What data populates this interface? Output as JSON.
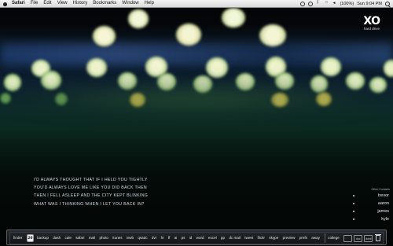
{
  "menubar": {
    "app": "Safari",
    "items": [
      "File",
      "Edit",
      "View",
      "History",
      "Bookmarks",
      "Window",
      "Help"
    ],
    "battery": "(100%)",
    "clock": "Sun 9:04 PM"
  },
  "widget": {
    "logo": "XO",
    "subtitle": "hard drive"
  },
  "lyrics": [
    "I'D ALWAYS THOUGHT THAT IF I HELD YOU TIGHTLY",
    "YOU'D ALWAYS LOVE ME LIKE YOU DID BACK THEN",
    "THEN I FELL ASLEEP AND THE CITY KEPT BLINKING",
    "WHAT WAS I THINKING WHEN I LET YOU BACK IN?"
  ],
  "contacts": {
    "title": "Other Contacts",
    "names": [
      "trevor",
      "aaron",
      "james",
      "kyle"
    ]
  },
  "dock": {
    "items": [
      "finder",
      "backup",
      "dash",
      "cale",
      "safari",
      "mail",
      "photo",
      "itunes",
      "ivwb",
      "qsadc",
      "dvr",
      "hr",
      "ff",
      "ai",
      "ps",
      "id",
      "word",
      "excel",
      "pp",
      "dc mail",
      "tweet",
      "flickr",
      "skype",
      "preview",
      "prefs",
      "away"
    ],
    "badge": "20",
    "after_badge": "college",
    "boxes": [
      "",
      "doc",
      "dwnl"
    ]
  },
  "colors": {
    "menubar": "#e6e6e6",
    "text": "#d7dde3"
  }
}
